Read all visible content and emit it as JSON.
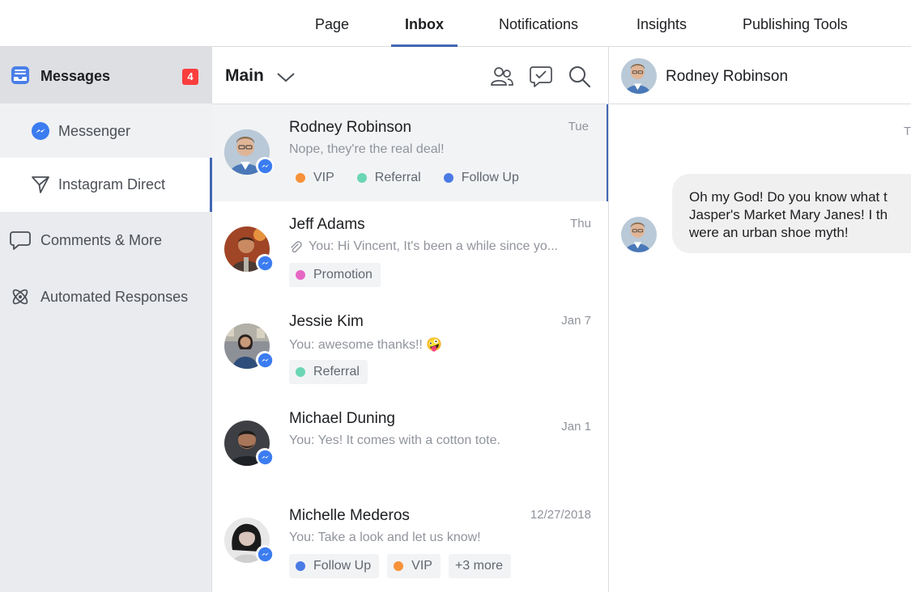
{
  "topnav": {
    "tabs": [
      {
        "label": "Page"
      },
      {
        "label": "Inbox"
      },
      {
        "label": "Notifications"
      },
      {
        "label": "Insights"
      },
      {
        "label": "Publishing Tools"
      }
    ],
    "active_tab": "Inbox"
  },
  "sidebar": {
    "messages": {
      "label": "Messages",
      "badge": "4",
      "icon": "inbox-tray-icon"
    },
    "items": [
      {
        "label": "Messenger",
        "icon": "messenger-icon"
      },
      {
        "label": "Instagram Direct",
        "icon": "paper-plane-icon"
      },
      {
        "label": "Comments & More",
        "icon": "speech-bubble-icon"
      },
      {
        "label": "Automated Responses",
        "icon": "atom-icon"
      }
    ]
  },
  "list": {
    "title": "Main",
    "conversations": [
      {
        "name": "Rodney Robinson",
        "date": "Tue",
        "preview": "Nope, they're the real deal!",
        "tags": [
          {
            "label": "VIP",
            "color": "#f7923a"
          },
          {
            "label": "Referral",
            "color": "#6bd6b4"
          },
          {
            "label": "Follow Up",
            "color": "#4b7be5"
          }
        ]
      },
      {
        "name": "Jeff Adams",
        "date": "Thu",
        "preview": "You: Hi Vincent, It's been a while since yo...",
        "tags": [
          {
            "label": "Promotion",
            "color": "#e667c4"
          }
        ]
      },
      {
        "name": "Jessie Kim",
        "date": "Jan 7",
        "preview": "You: awesome thanks!! 🤪",
        "tags": [
          {
            "label": "Referral",
            "color": "#6bd6b4"
          }
        ]
      },
      {
        "name": "Michael Duning",
        "date": "Jan 1",
        "preview": "You: Yes! It comes with a cotton tote.",
        "tags": []
      },
      {
        "name": "Michelle Mederos",
        "date": "12/27/2018",
        "preview": "You: Take a look and let us know!",
        "tags": [
          {
            "label": "Follow Up",
            "color": "#4b7be5"
          },
          {
            "label": "VIP",
            "color": "#f7923a"
          },
          {
            "label": "+3 more",
            "color": ""
          }
        ]
      }
    ]
  },
  "chat": {
    "contact_name": "Rodney Robinson",
    "timestamp_partial": "T",
    "message_lines": [
      "Oh my God! Do you know what t",
      "Jasper's Market Mary Janes! I th",
      "were an urban shoe myth!"
    ]
  },
  "colors": {
    "accent": "#4267b2",
    "badge": "#fa3e3e",
    "messenger_blue": "#3b7cf0"
  }
}
